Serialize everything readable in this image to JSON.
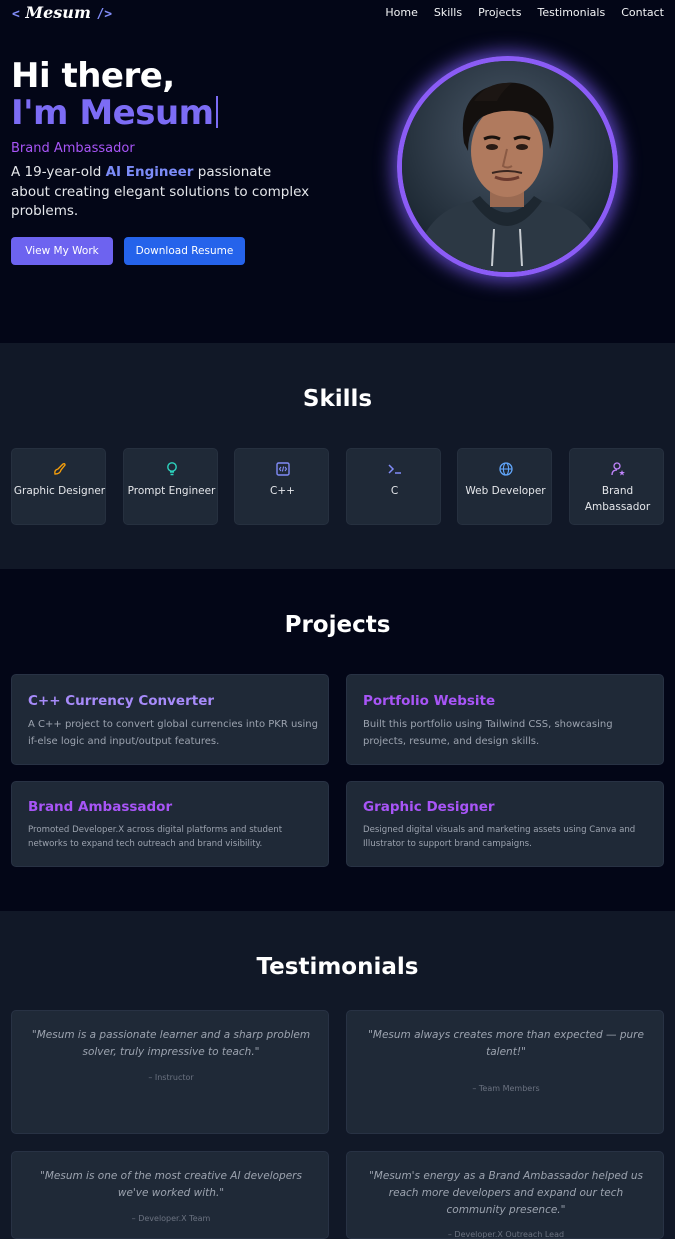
{
  "nav": {
    "logo_open": "<",
    "logo_text": "Mesum",
    "logo_close": "/>",
    "links": [
      "Home",
      "Skills",
      "Projects",
      "Testimonials",
      "Contact"
    ]
  },
  "hero": {
    "greeting": "Hi there,",
    "name": "I'm Mesum",
    "role": "Brand Ambassador",
    "desc_pre": "A 19-year-old ",
    "desc_highlight": "AI Engineer",
    "desc_post": " passionate about creating elegant solutions to complex problems.",
    "btn_work": "View My Work",
    "btn_resume": "Download Resume"
  },
  "skills": {
    "title": "Skills",
    "items": [
      {
        "label": "Graphic Designer",
        "icon": "brush-icon",
        "color": "#f59e0b"
      },
      {
        "label": "Prompt Engineer",
        "icon": "lightbulb-icon",
        "color": "#2dd4bf"
      },
      {
        "label": "C++",
        "icon": "code-file-icon",
        "color": "#818cf8"
      },
      {
        "label": "C",
        "icon": "terminal-icon",
        "color": "#818cf8"
      },
      {
        "label": "Web Developer",
        "icon": "globe-icon",
        "color": "#60a5fa"
      },
      {
        "label": "Brand Ambassador",
        "icon": "user-star-icon",
        "color": "#c084fc"
      }
    ]
  },
  "projects": {
    "title": "Projects",
    "items": [
      {
        "title": "C++ Currency Converter",
        "desc": "A C++ project to convert global currencies into PKR using if-else logic and input/output features."
      },
      {
        "title": "Portfolio Website",
        "desc": "Built this portfolio using Tailwind CSS, showcasing projects, resume, and design skills."
      },
      {
        "title": "Brand Ambassador",
        "desc": "Promoted Developer.X across digital platforms and student networks to expand tech outreach and brand visibility."
      },
      {
        "title": "Graphic Designer",
        "desc": "Designed digital visuals and marketing assets using Canva and Illustrator to support brand campaigns."
      }
    ]
  },
  "testimonials": {
    "title": "Testimonials",
    "items": [
      {
        "quote": "\"Mesum is a passionate learner and a sharp problem solver, truly impressive to teach.\"",
        "author": "– Instructor"
      },
      {
        "quote": "\"Mesum always creates more than expected — pure talent!\"",
        "author": "– Team Members"
      },
      {
        "quote": "\"Mesum is one of the most creative AI developers we've worked with.\"",
        "author": "– Developer.X Team"
      },
      {
        "quote": "\"Mesum's energy as a Brand Ambassador helped us reach more developers and expand our tech community presence.\"",
        "author": "– Developer.X Outreach Lead"
      }
    ]
  },
  "colors": {
    "accent": "#7c6cf5",
    "purple": "#a855f7",
    "blue_button": "#2563eb",
    "bg": "#030617",
    "section_bg": "#111827",
    "card_bg": "#1f2937"
  }
}
